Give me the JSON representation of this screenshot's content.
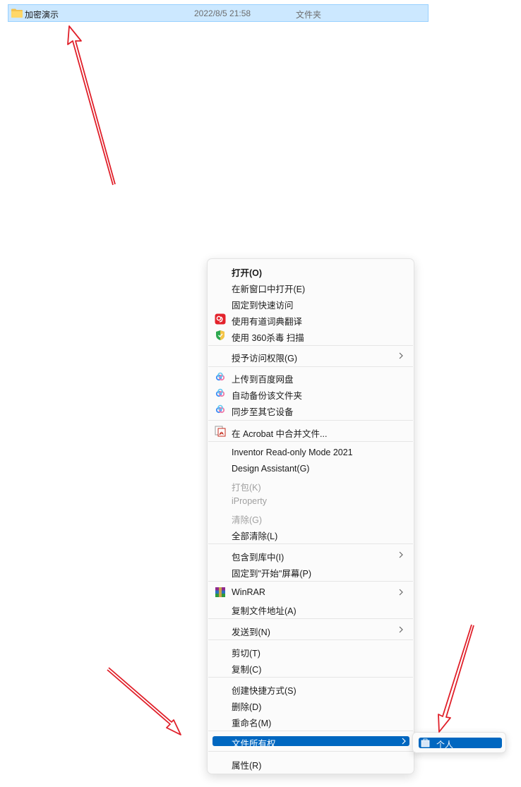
{
  "file": {
    "name": "加密演示",
    "date": "2022/8/5 21:58",
    "type": "文件夹"
  },
  "menu": {
    "open": "打开(O)",
    "open_new_window": "在新窗口中打开(E)",
    "pin_quick_access": "固定到快速访问",
    "youdao_translate": "使用有道词典翻译",
    "scan_360": "使用 360杀毒 扫描",
    "grant_access": "授予访问权限(G)",
    "baidu_upload": "上传到百度网盘",
    "baidu_backup": "自动备份该文件夹",
    "baidu_sync": "同步至其它设备",
    "acrobat_combine": "在 Acrobat 中合并文件...",
    "inventor_readonly": "Inventor Read-only Mode 2021",
    "design_assistant": "Design Assistant(G)",
    "pack": "打包(K)",
    "iproperty": "iProperty",
    "clear": "清除(G)",
    "clear_all": "全部清除(L)",
    "include_library": "包含到库中(I)",
    "pin_start": "固定到\"开始\"屏幕(P)",
    "winrar": "WinRAR",
    "copy_path": "复制文件地址(A)",
    "send_to": "发送到(N)",
    "cut": "剪切(T)",
    "copy": "复制(C)",
    "create_shortcut": "创建快捷方式(S)",
    "delete": "删除(D)",
    "rename": "重命名(M)",
    "file_ownership": "文件所有权",
    "properties": "属性(R)"
  },
  "submenu": {
    "personal": "个人"
  },
  "colors": {
    "selection_blue": "#0067c0",
    "file_selected_bg": "#cce8ff",
    "arrow_red": "#e0202a"
  }
}
